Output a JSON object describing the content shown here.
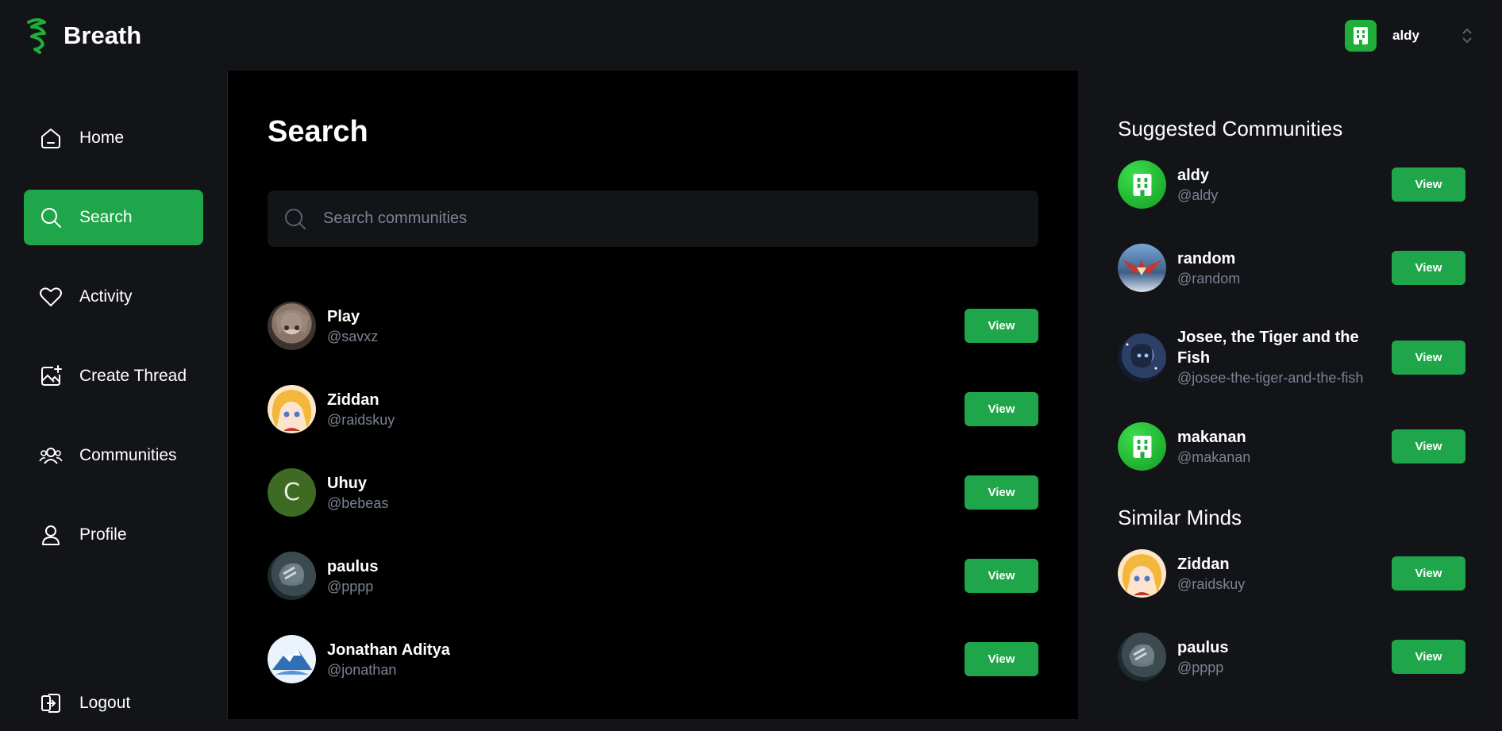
{
  "app": {
    "name": "Breath"
  },
  "org": {
    "name": "aldy"
  },
  "nav": {
    "items": [
      {
        "label": "Home",
        "icon": "home-icon"
      },
      {
        "label": "Search",
        "icon": "search-icon",
        "active": true
      },
      {
        "label": "Activity",
        "icon": "heart-icon"
      },
      {
        "label": "Create Thread",
        "icon": "image-plus-icon"
      },
      {
        "label": "Communities",
        "icon": "users-icon"
      },
      {
        "label": "Profile",
        "icon": "user-icon"
      }
    ],
    "logout": "Logout"
  },
  "main": {
    "title": "Search",
    "search": {
      "placeholder": "Search communities",
      "value": ""
    },
    "results": [
      {
        "name": "Play",
        "handle": "@savxz",
        "avatar": "anime-portrait-1"
      },
      {
        "name": "Ziddan",
        "handle": "@raidskuy",
        "avatar": "anime-blonde-girl"
      },
      {
        "name": "Uhuy",
        "handle": "@bebeas",
        "avatar": "letter-avatar",
        "initial": "C"
      },
      {
        "name": "paulus",
        "handle": "@pppp",
        "avatar": "photo-person"
      },
      {
        "name": "Jonathan Aditya",
        "handle": "@jonathan",
        "avatar": "photo-landscape"
      }
    ],
    "view_label": "View"
  },
  "suggested": {
    "title": "Suggested Communities",
    "items": [
      {
        "name": "aldy",
        "handle": "@aldy",
        "avatar": "building-icon"
      },
      {
        "name": "random",
        "handle": "@random",
        "avatar": "anime-wings"
      },
      {
        "name": "Josee, the Tiger and the Fish",
        "handle": "@josee-the-tiger-and-the-fish",
        "avatar": "anime-blue"
      },
      {
        "name": "makanan",
        "handle": "@makanan",
        "avatar": "building-icon"
      }
    ]
  },
  "similar": {
    "title": "Similar Minds",
    "items": [
      {
        "name": "Ziddan",
        "handle": "@raidskuy",
        "avatar": "anime-blonde-girl"
      },
      {
        "name": "paulus",
        "handle": "@pppp",
        "avatar": "photo-person"
      }
    ]
  },
  "colors": {
    "accent": "#1fa64a",
    "background": "#121417",
    "main_background": "#000000",
    "muted_text": "#7a8294"
  }
}
